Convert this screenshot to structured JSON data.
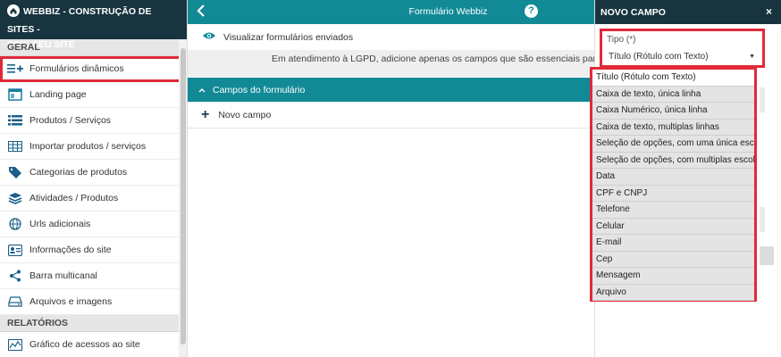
{
  "brand": {
    "line1": "WEBBIZ - CONSTRUÇÃO DE SITES -",
    "line2": "CRIE SEU SITE"
  },
  "sidebar": {
    "section_geral": "GERAL",
    "items": [
      {
        "label": "Formulários dinâmicos",
        "icon": "form-list-icon"
      },
      {
        "label": "Landing page",
        "icon": "landing-icon"
      },
      {
        "label": "Produtos / Serviços",
        "icon": "list-icon"
      },
      {
        "label": "Importar produtos / serviços",
        "icon": "table-icon"
      },
      {
        "label": "Categorias de produtos",
        "icon": "tags-icon"
      },
      {
        "label": "Atividades / Produtos",
        "icon": "layers-icon"
      },
      {
        "label": "Urls adicionais",
        "icon": "globe-icon"
      },
      {
        "label": "Informações do site",
        "icon": "id-card-icon"
      },
      {
        "label": "Barra multicanal",
        "icon": "share-icon"
      },
      {
        "label": "Arquivos e imagens",
        "icon": "drive-icon"
      }
    ],
    "section_relatorios": "RELATÓRIOS",
    "report_items": [
      {
        "label": "Gráfico de acessos ao site",
        "icon": "chart-icon"
      }
    ]
  },
  "main": {
    "title": "Formulário Webbiz",
    "help": "?",
    "view_forms": "Visualizar formulários enviados",
    "notice": "Em atendimento à LGPD, adicione apenas os campos que são essenciais para o seu co",
    "fields_header": "Campos do formulário",
    "new_field": "Novo campo"
  },
  "panel": {
    "title": "NOVO CAMPO",
    "close": "×",
    "tipo_label": "Tipo (*)",
    "tipo_value": "Título (Rótulo com Texto)"
  },
  "dropdown": {
    "options": [
      "Título (Rótulo com Texto)",
      "Caixa de texto, única linha",
      "Caixa Numérico, única linha",
      "Caixa de texto, multiplas linhas",
      "Seleção de opções, com uma única escolha",
      "Seleção de opções, com multiplas escolhas",
      "Data",
      "CPF e CNPJ",
      "Telefone",
      "Celular",
      "E-mail",
      "Cep",
      "Mensagem",
      "Arquivo"
    ],
    "selected_index": 0
  },
  "colors": {
    "teal": "#118a96",
    "navy": "#17343f",
    "highlight": "#e02a3a"
  }
}
